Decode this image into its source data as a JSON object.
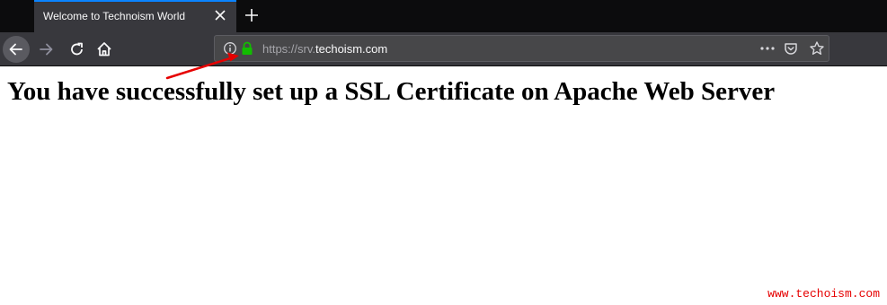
{
  "browser": {
    "tab": {
      "title": "Welcome to Technoism World"
    },
    "url": {
      "prefix": "https://srv.",
      "host": "techoism.com"
    },
    "icons": {
      "back": "back-arrow-icon",
      "forward": "forward-arrow-icon",
      "reload": "reload-icon",
      "home": "home-icon",
      "info": "info-icon",
      "lock": "lock-icon",
      "more": "meatball-menu-icon",
      "pocket": "pocket-icon",
      "bookmark": "star-icon",
      "close": "close-icon",
      "new_tab": "plus-icon"
    },
    "colors": {
      "lock": "#12bc00",
      "tab_accent": "#0a84ff",
      "annotation_arrow": "#e60000"
    }
  },
  "page": {
    "heading": "You have successfully set up a SSL Certificate on Apache Web Server",
    "watermark": "www.techoism.com"
  }
}
